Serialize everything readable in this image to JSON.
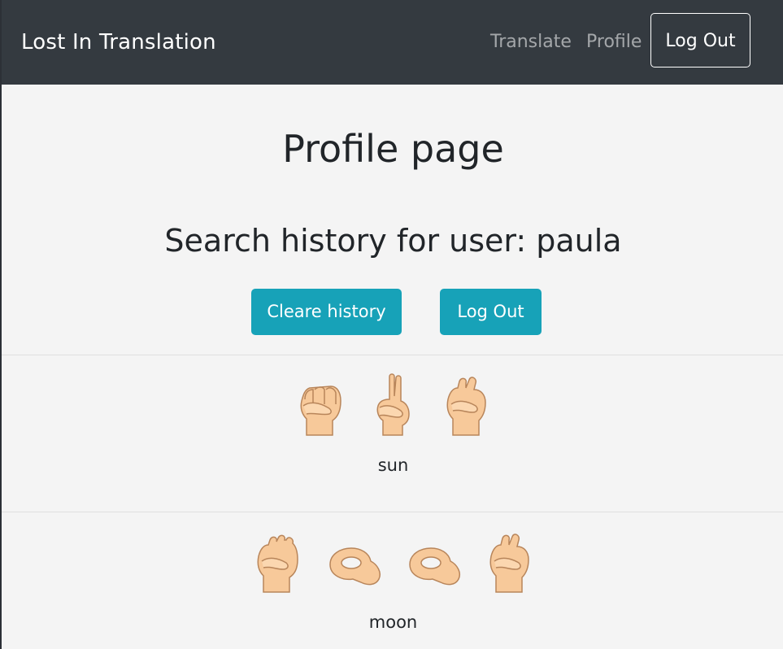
{
  "navbar": {
    "brand": "Lost In Translation",
    "links": {
      "translate": "Translate",
      "profile": "Profile",
      "logout": "Log Out"
    }
  },
  "main": {
    "title": "Profile page",
    "history_title": "Search history for user: paula",
    "buttons": {
      "clear": "Cleare history",
      "logout": "Log Out"
    },
    "history": [
      {
        "word": "sun",
        "signs": [
          "s-hand-sign-icon",
          "u-hand-sign-icon",
          "n-hand-sign-icon"
        ]
      },
      {
        "word": "moon",
        "signs": [
          "m-hand-sign-icon",
          "o-hand-sign-icon",
          "o-hand-sign-icon",
          "n-hand-sign-icon"
        ]
      }
    ]
  },
  "colors": {
    "navbar": "#343a40",
    "accent": "#17a2b8",
    "background": "#f4f4f4",
    "skin": "#f7c99a"
  }
}
